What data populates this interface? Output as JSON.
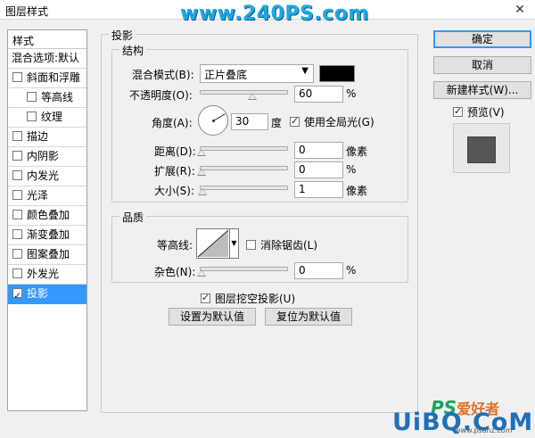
{
  "window": {
    "title": "图层样式",
    "watermark": "www.240PS.com"
  },
  "left_panel": {
    "header": "样式",
    "items": [
      {
        "label": "混合选项:默认",
        "checkbox": false,
        "checked": false,
        "indent": false
      },
      {
        "label": "斜面和浮雕",
        "checkbox": true,
        "checked": false,
        "indent": false
      },
      {
        "label": "等高线",
        "checkbox": true,
        "checked": false,
        "indent": true
      },
      {
        "label": "纹理",
        "checkbox": true,
        "checked": false,
        "indent": true
      },
      {
        "label": "描边",
        "checkbox": true,
        "checked": false,
        "indent": false
      },
      {
        "label": "内阴影",
        "checkbox": true,
        "checked": false,
        "indent": false
      },
      {
        "label": "内发光",
        "checkbox": true,
        "checked": false,
        "indent": false
      },
      {
        "label": "光泽",
        "checkbox": true,
        "checked": false,
        "indent": false
      },
      {
        "label": "颜色叠加",
        "checkbox": true,
        "checked": false,
        "indent": false
      },
      {
        "label": "渐变叠加",
        "checkbox": true,
        "checked": false,
        "indent": false
      },
      {
        "label": "图案叠加",
        "checkbox": true,
        "checked": false,
        "indent": false
      },
      {
        "label": "外发光",
        "checkbox": true,
        "checked": false,
        "indent": false
      },
      {
        "label": "投影",
        "checkbox": true,
        "checked": true,
        "indent": false,
        "selected": true
      }
    ]
  },
  "drop_shadow": {
    "section_title": "投影",
    "structure": {
      "title": "结构",
      "blend_mode_label": "混合模式(B):",
      "blend_mode_value": "正片叠底",
      "shadow_color": "#000000",
      "opacity_label": "不透明度(O):",
      "opacity_value": "60",
      "opacity_fraction": 0.6,
      "opacity_unit": "%",
      "angle_label": "角度(A):",
      "angle_value": "30",
      "angle_unit": "度",
      "global_light_label": "使用全局光(G)",
      "global_light_checked": true,
      "distance_label": "距离(D):",
      "distance_value": "0",
      "distance_unit": "像素",
      "distance_fraction": 0,
      "spread_label": "扩展(R):",
      "spread_value": "0",
      "spread_unit": "%",
      "spread_fraction": 0,
      "size_label": "大小(S):",
      "size_value": "1",
      "size_unit": "像素",
      "size_fraction": 0.01
    },
    "quality": {
      "title": "品质",
      "contour_label": "等高线:",
      "anti_alias_label": "消除锯齿(L)",
      "anti_alias_checked": false,
      "noise_label": "杂色(N):",
      "noise_value": "0",
      "noise_unit": "%",
      "noise_fraction": 0
    },
    "knockout_label": "图层挖空投影(U)",
    "knockout_checked": true,
    "make_default_label": "设置为默认值",
    "reset_default_label": "复位为默认值"
  },
  "right_panel": {
    "ok_label": "确定",
    "cancel_label": "取消",
    "new_style_label": "新建样式(W)...",
    "preview_label": "预览(V)",
    "preview_checked": true
  },
  "branding": {
    "ps_text": "PS",
    "cn_text": "爱好者",
    "site_text": "UiBQ.CoM",
    "small_text": "www.psahz.com"
  }
}
